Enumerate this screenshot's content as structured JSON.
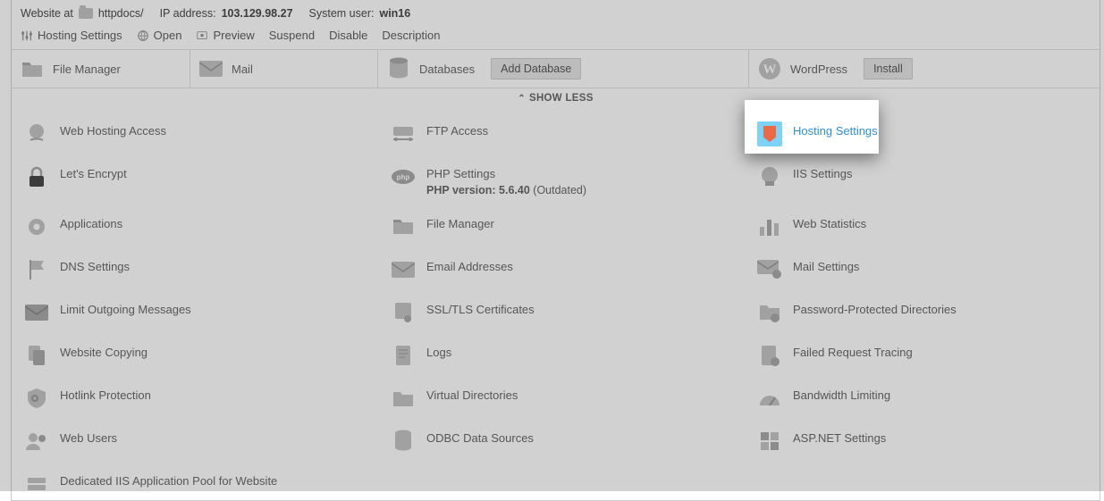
{
  "info": {
    "website_label": "Website at",
    "website_path": "httpdocs/",
    "ip_label": "IP address:",
    "ip_value": "103.129.98.27",
    "user_label": "System user:",
    "user_value": "win16"
  },
  "toolbar": {
    "hosting_settings": "Hosting Settings",
    "open": "Open",
    "preview": "Preview",
    "suspend": "Suspend",
    "disable": "Disable",
    "description": "Description"
  },
  "cards": {
    "file_manager": "File Manager",
    "mail": "Mail",
    "databases": "Databases",
    "add_database": "Add Database",
    "wordpress": "WordPress",
    "install": "Install"
  },
  "showless": "SHOW LESS",
  "tools": {
    "col1": {
      "web_hosting_access": "Web Hosting Access",
      "lets_encrypt": "Let's Encrypt",
      "applications": "Applications",
      "dns_settings": "DNS Settings",
      "limit_outgoing": "Limit Outgoing Messages",
      "website_copying": "Website Copying",
      "hotlink_protection": "Hotlink Protection",
      "web_users": "Web Users",
      "iis_pool": "Dedicated IIS Application Pool for Website"
    },
    "col2": {
      "ftp_access": "FTP Access",
      "php_settings": "PHP Settings",
      "php_sub_bold": "PHP version: 5.6.40",
      "php_sub_plain": " (Outdated)",
      "file_manager": "File Manager",
      "email_addresses": "Email Addresses",
      "ssl": "SSL/TLS Certificates",
      "logs": "Logs",
      "virtual_dirs": "Virtual Directories",
      "odbc": "ODBC Data Sources"
    },
    "col3": {
      "hosting_settings": "Hosting Settings",
      "iis_settings": "IIS Settings",
      "web_statistics": "Web Statistics",
      "mail_settings": "Mail Settings",
      "pwd_dirs": "Password-Protected Directories",
      "failed_request": "Failed Request Tracing",
      "bandwidth": "Bandwidth Limiting",
      "aspnet": "ASP.NET Settings"
    }
  }
}
